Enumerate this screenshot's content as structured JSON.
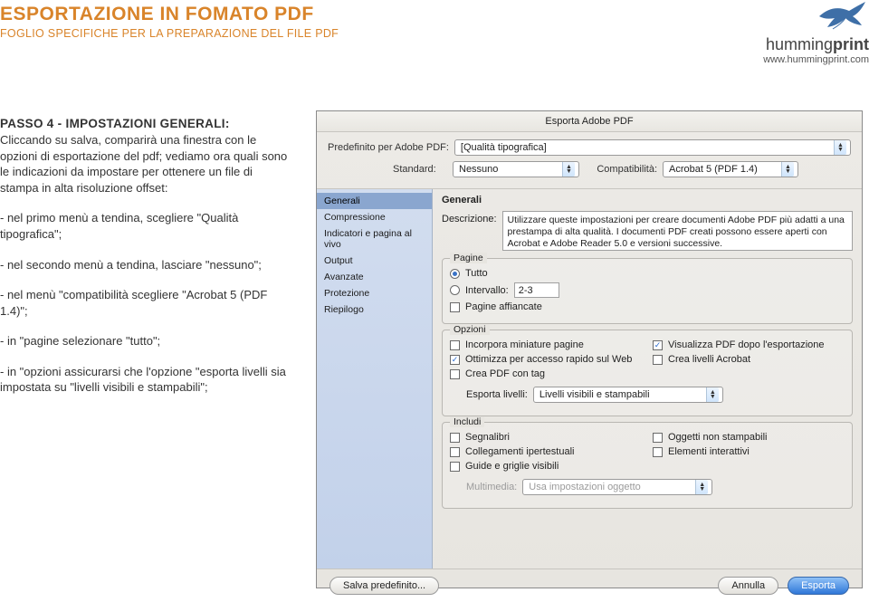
{
  "header": {
    "title": "ESPORTAZIONE IN FOMATO PDF",
    "subtitle": "FOGLIO SPECIFICHE PER LA PREPARAZIONE DEL FILE PDF",
    "brand_name_light": "humming",
    "brand_name_bold": "print",
    "url": "www.hummingprint.com"
  },
  "left": {
    "step_title": "PASSO 4 - IMPOSTAZIONI GENERALI:",
    "intro": "Cliccando su salva, comparirà una finestra con le opzioni di esportazione del pdf; vediamo ora quali sono le indicazioni da impostare per ottenere un file di stampa in alta risoluzione offset:",
    "li1": "- nel primo menù a tendina, scegliere \"Qualità tipografica\";",
    "li2": "- nel secondo menù a tendina, lasciare \"nessuno\";",
    "li3": "- nel menù \"compatibilità scegliere \"Acrobat 5 (PDF 1.4)\";",
    "li4": "- in \"pagine selezionare \"tutto\";",
    "li5": "- in \"opzioni assicurarsi che l'opzione \"esporta livelli sia impostata su \"livelli visibili e stampabili\";"
  },
  "dialog": {
    "title": "Esporta Adobe PDF",
    "preset_label": "Predefinito per Adobe PDF:",
    "preset_value": "[Qualità tipografica]",
    "standard_label": "Standard:",
    "standard_value": "Nessuno",
    "compat_label": "Compatibilità:",
    "compat_value": "Acrobat 5 (PDF 1.4)",
    "sidebar": [
      "Generali",
      "Compressione",
      "Indicatori e pagina al vivo",
      "Output",
      "Avanzate",
      "Protezione",
      "Riepilogo"
    ],
    "panel_head": "Generali",
    "desc_label": "Descrizione:",
    "desc_text": "Utilizzare queste impostazioni per creare documenti Adobe PDF più adatti a una prestampa di alta qualità. I documenti PDF creati possono essere aperti con Acrobat e Adobe Reader 5.0 e versioni successive.",
    "grp_pages": "Pagine",
    "radio_all": "Tutto",
    "radio_range_label": "Intervallo:",
    "radio_range_value": "2-3",
    "chk_spreads": "Pagine affiancate",
    "grp_options": "Opzioni",
    "chk_thumb": "Incorpora miniature pagine",
    "chk_fastweb": "Ottimizza per accesso rapido sul Web",
    "chk_tagged": "Crea PDF con tag",
    "chk_viewpdf": "Visualizza PDF dopo l'esportazione",
    "chk_acrolayers": "Crea livelli Acrobat",
    "export_layers_label": "Esporta livelli:",
    "export_layers_value": "Livelli visibili e stampabili",
    "grp_include": "Includi",
    "chk_bookmarks": "Segnalibri",
    "chk_hyperlinks": "Collegamenti ipertestuali",
    "chk_guides": "Guide e griglie visibili",
    "chk_nonprint": "Oggetti non stampabili",
    "chk_interactive": "Elementi interattivi",
    "multimedia_label": "Multimedia:",
    "multimedia_value": "Usa impostazioni oggetto",
    "btn_save_preset": "Salva predefinito...",
    "btn_cancel": "Annulla",
    "btn_export": "Esporta"
  }
}
